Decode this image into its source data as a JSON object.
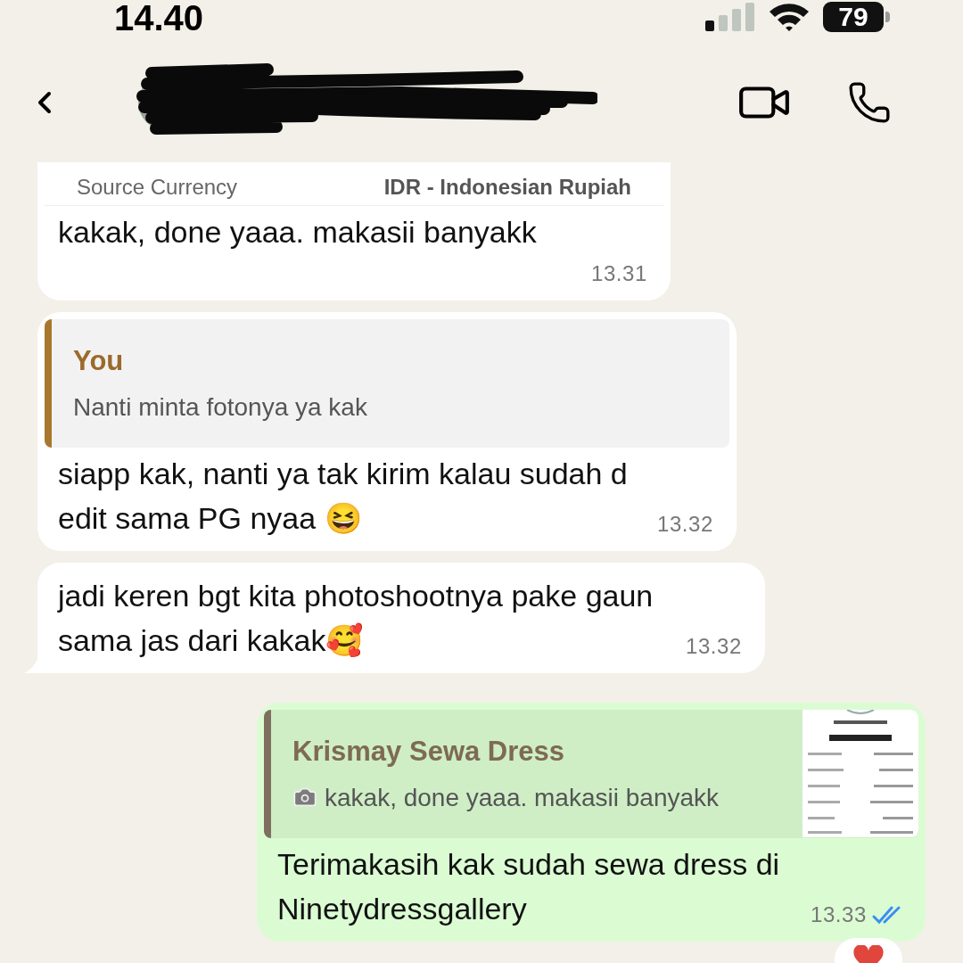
{
  "status_bar": {
    "time": "14.40",
    "battery": "79"
  },
  "messages": [
    {
      "kind": "incoming",
      "image_fragment": {
        "label": "Source Currency",
        "value": "IDR - Indonesian Rupiah"
      },
      "text": "kakak, done yaaa. makasii banyakk",
      "time": "13.31",
      "tail": false
    },
    {
      "kind": "incoming",
      "quote": {
        "author": "You",
        "text": "Nanti minta fotonya ya kak",
        "photo": false
      },
      "text": "siapp kak, nanti ya tak kirim kalau sudah d edit sama PG nyaa 😆",
      "time": "13.32",
      "tail": false
    },
    {
      "kind": "incoming",
      "text": "jadi keren bgt kita photoshootnya pake gaun sama jas dari kakak🥰",
      "time": "13.32",
      "tail": true
    },
    {
      "kind": "outgoing",
      "quote": {
        "author": "Krismay Sewa Dress",
        "text": "kakak, done yaaa. makasii banyakk",
        "photo": true
      },
      "text": "Terimakasih kak sudah sewa dress di Ninetydressgallery",
      "time": "13.33",
      "read": true,
      "tail": false,
      "reaction": true
    }
  ]
}
